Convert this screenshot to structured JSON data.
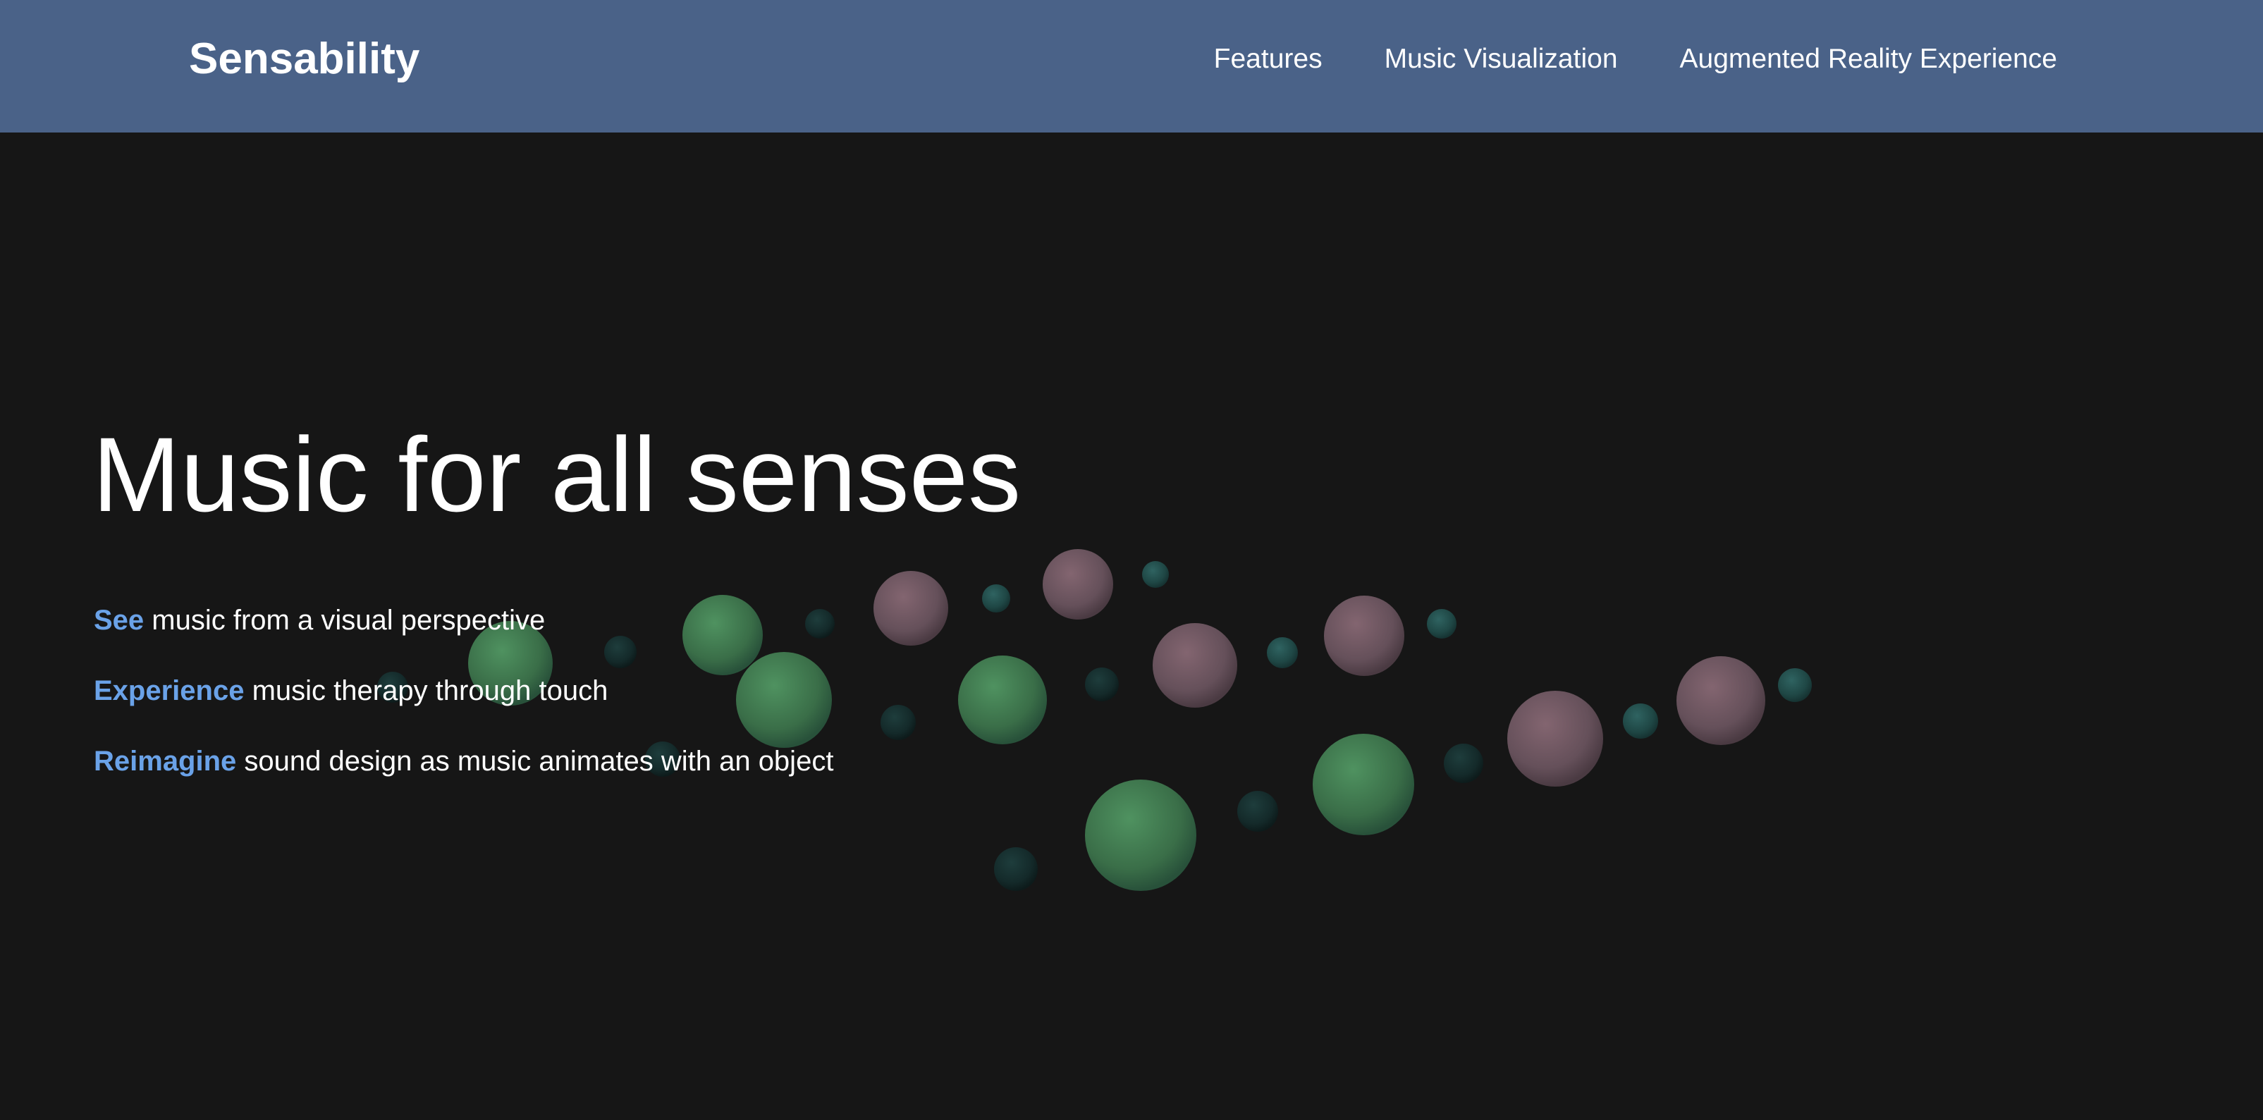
{
  "header": {
    "brand": "Sensability",
    "nav": [
      {
        "label": "Features"
      },
      {
        "label": "Music Visualization"
      },
      {
        "label": "Augmented Reality Experience"
      }
    ]
  },
  "hero": {
    "title": "Music for all senses",
    "taglines": [
      {
        "accent": "See",
        "text": " music from a visual perspective"
      },
      {
        "accent": "Experience",
        "text": " music therapy through touch"
      },
      {
        "accent": "Reimagine",
        "text": " sound design as music animates with an object"
      }
    ]
  },
  "colors": {
    "navbar": "#4a6288",
    "background": "#161616",
    "accent": "#6aa2e8",
    "sphere_green": "#3e7a4e",
    "sphere_pink": "#6e5560",
    "sphere_teal": "#1f4a48"
  }
}
